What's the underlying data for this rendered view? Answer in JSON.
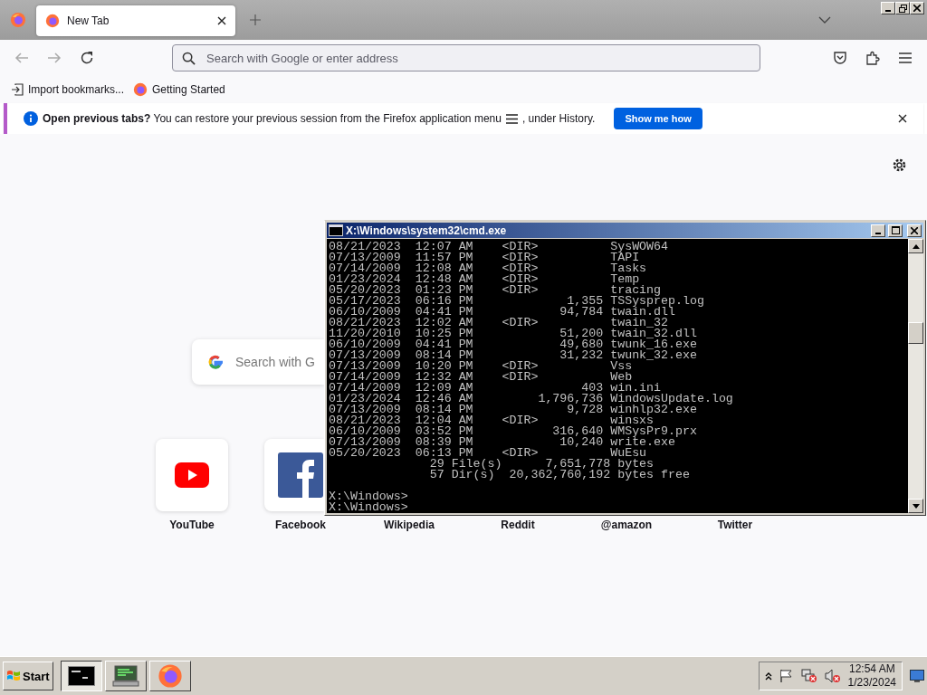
{
  "browser": {
    "tabs": [
      {
        "label": "New Tab",
        "selected": true
      }
    ],
    "address": {
      "placeholder": "Search with Google or enter address"
    },
    "bookmarks": [
      {
        "label": "Import bookmarks...",
        "kind": "import"
      },
      {
        "label": "Getting Started",
        "kind": "firefox"
      }
    ],
    "notification": {
      "title": "Open previous tabs?",
      "message": "You can restore your previous session from the Firefox application menu",
      "message_end": ", under History.",
      "button": "Show me how"
    },
    "newtab": {
      "search_placeholder": "Search with G",
      "shortcuts": [
        {
          "label": "YouTube",
          "kind": "youtube"
        },
        {
          "label": "Facebook",
          "kind": "facebook"
        },
        {
          "label": "Wikipedia",
          "kind": "hidden"
        },
        {
          "label": "Reddit",
          "kind": "hidden"
        },
        {
          "label": "@amazon",
          "kind": "hidden"
        },
        {
          "label": "Twitter",
          "kind": "hidden"
        }
      ]
    }
  },
  "console": {
    "title": "X:\\Windows\\system32\\cmd.exe",
    "listing": [
      "08/21/2023  12:07 AM    <DIR>          SysWOW64",
      "07/13/2009  11:57 PM    <DIR>          TAPI",
      "07/14/2009  12:08 AM    <DIR>          Tasks",
      "01/23/2024  12:48 AM    <DIR>          Temp",
      "05/20/2023  01:23 PM    <DIR>          tracing",
      "05/17/2023  06:16 PM             1,355 TSSysprep.log",
      "06/10/2009  04:41 PM            94,784 twain.dll",
      "08/21/2023  12:02 AM    <DIR>          twain_32",
      "11/20/2010  10:25 PM            51,200 twain_32.dll",
      "06/10/2009  04:41 PM            49,680 twunk_16.exe",
      "07/13/2009  08:14 PM            31,232 twunk_32.exe",
      "07/13/2009  10:20 PM    <DIR>          Vss",
      "07/14/2009  12:32 AM    <DIR>          Web",
      "07/14/2009  12:09 AM               403 win.ini",
      "01/23/2024  12:46 AM         1,796,736 WindowsUpdate.log",
      "07/13/2009  08:14 PM             9,728 winhlp32.exe",
      "08/21/2023  12:04 AM    <DIR>          winsxs",
      "06/10/2009  03:52 PM           316,640 WMSysPr9.prx",
      "07/13/2009  08:39 PM            10,240 write.exe",
      "05/20/2023  06:13 PM    <DIR>          WuEsu",
      "              29 File(s)      7,651,778 bytes",
      "              57 Dir(s)  20,362,760,192 bytes free"
    ],
    "prompts": [
      "X:\\Windows>",
      "X:\\Windows>"
    ]
  },
  "taskbar": {
    "start": "Start",
    "apps": [
      {
        "kind": "console",
        "selected": true
      },
      {
        "kind": "monitor",
        "selected": false
      },
      {
        "kind": "firefox",
        "selected": false
      }
    ],
    "clock": {
      "time": "12:54 AM",
      "date": "1/23/2024"
    }
  }
}
